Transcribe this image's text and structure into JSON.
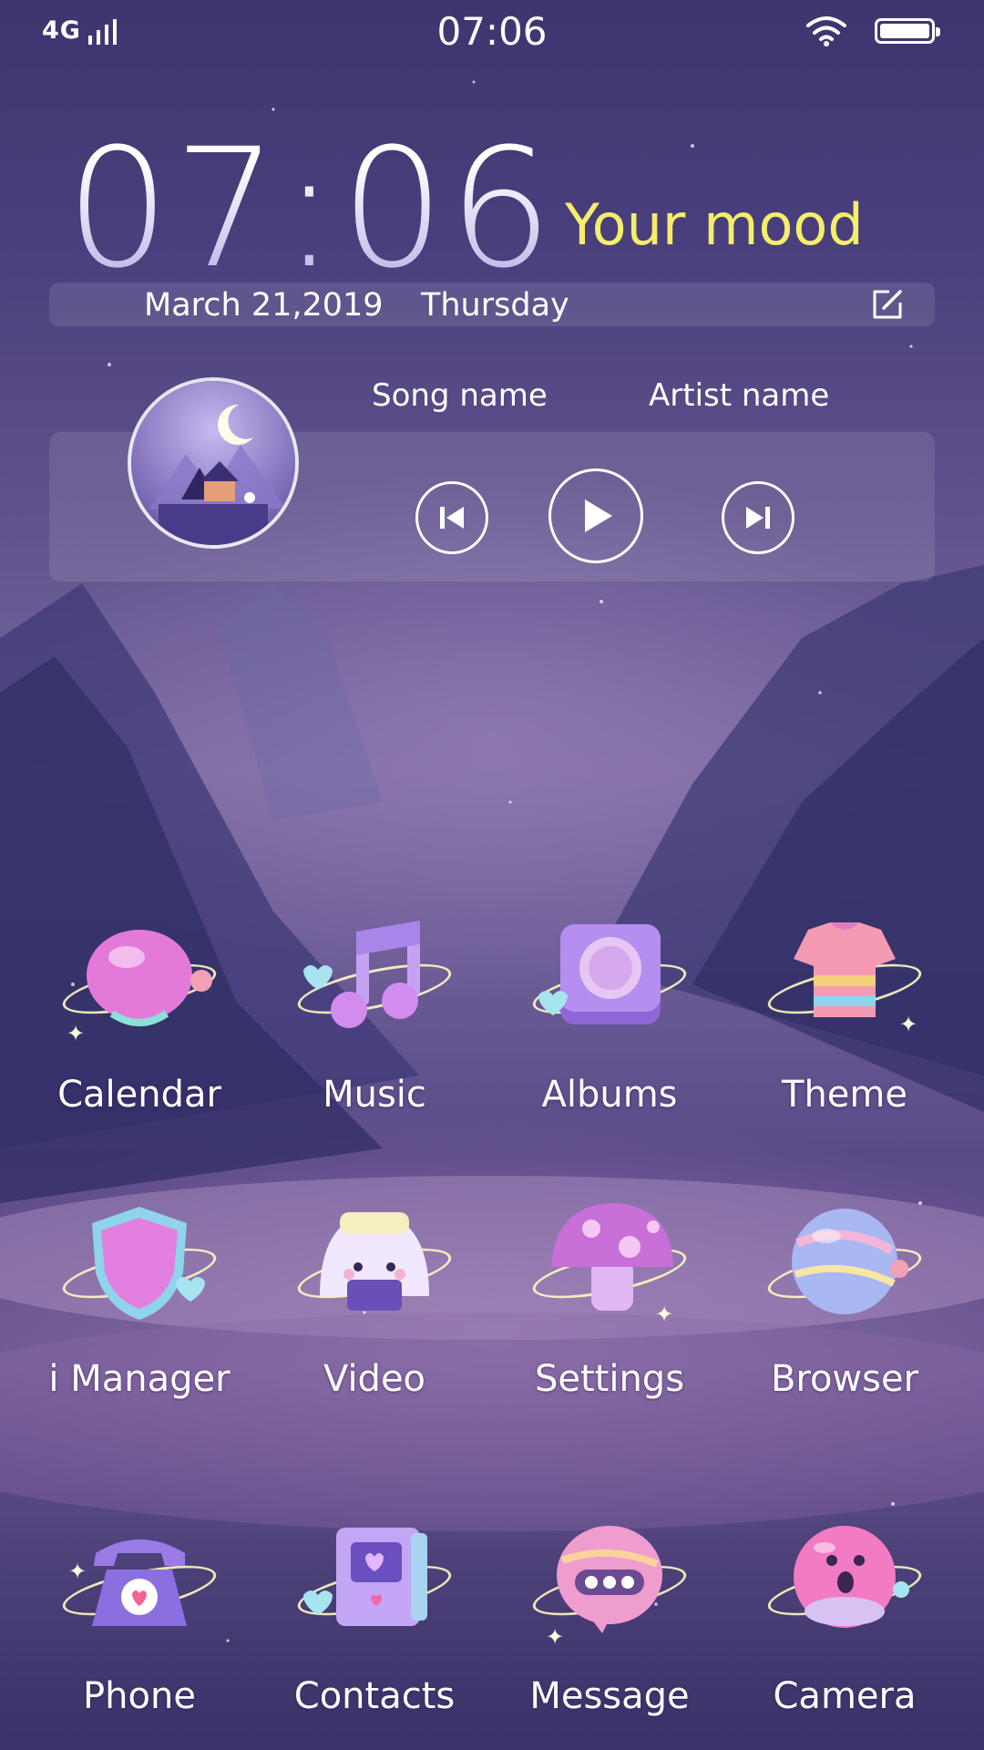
{
  "status_bar": {
    "network": "4G",
    "time": "07:06"
  },
  "clock_widget": {
    "time": "07:06",
    "mood_label": "Your mood",
    "date": "March 21,2019",
    "day": "Thursday"
  },
  "music_widget": {
    "song": "Song name",
    "artist": "Artist name"
  },
  "apps": [
    {
      "label": "Calendar",
      "icon": "calendar-icon",
      "color": "#e37ad9"
    },
    {
      "label": "Music",
      "icon": "music-icon",
      "color": "#b98cf0"
    },
    {
      "label": "Albums",
      "icon": "albums-icon",
      "color": "#9a6fe0"
    },
    {
      "label": "Theme",
      "icon": "theme-icon",
      "color": "#f59ab3"
    },
    {
      "label": "i Manager",
      "icon": "shield-icon",
      "color": "#e27fe0"
    },
    {
      "label": "Video",
      "icon": "video-icon",
      "color": "#f1e7ff"
    },
    {
      "label": "Settings",
      "icon": "settings-icon",
      "color": "#c96fd8"
    },
    {
      "label": "Browser",
      "icon": "browser-icon",
      "color": "#a9b7f3"
    },
    {
      "label": "Phone",
      "icon": "phone-icon",
      "color": "#8a6fe0"
    },
    {
      "label": "Contacts",
      "icon": "contacts-icon",
      "color": "#c3a6f5"
    },
    {
      "label": "Message",
      "icon": "message-icon",
      "color": "#ef9ccf"
    },
    {
      "label": "Camera",
      "icon": "camera-icon",
      "color": "#f27bc3"
    }
  ],
  "colors": {
    "mood": "#f4ee6a",
    "accent": "#7b6a9f"
  }
}
